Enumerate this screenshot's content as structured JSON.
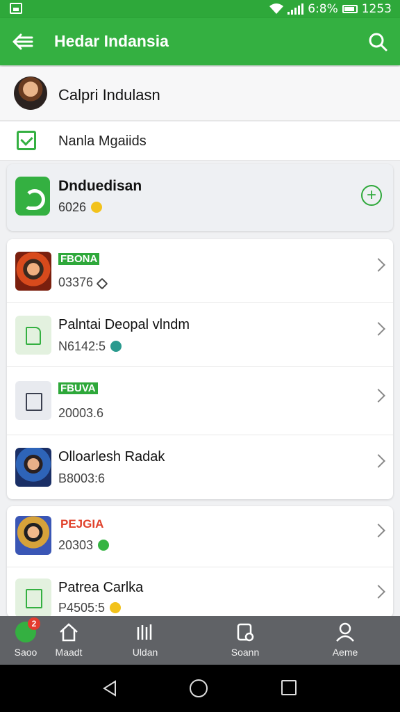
{
  "status_bar": {
    "battery_text": "6:8%",
    "time": "1253"
  },
  "app_bar": {
    "title": "Hedar Indansia",
    "back_icon": "back-arrow-icon",
    "search_icon": "search-icon",
    "background_color": "#34b041"
  },
  "account": {
    "name": "Calpri Indulasn"
  },
  "sub_row": {
    "label": "Nanla Mgaiids"
  },
  "featured": {
    "name": "Dnduedisan",
    "meta": "6026",
    "action_icon": "add-circle-icon"
  },
  "list1": [
    {
      "tag": "FBONA",
      "title": "",
      "sub": "03376",
      "thumb": "photo-a",
      "emoji": "outline"
    },
    {
      "tag": "",
      "title": "Palntai Deopal vlndm",
      "sub": "N6142:5",
      "thumb": "doc-green",
      "emoji": "teal"
    },
    {
      "tag": "FBUVA",
      "title": "",
      "sub": "20003.6",
      "thumb": "doc-grey",
      "emoji": ""
    },
    {
      "tag": "",
      "title": "Olloarlesh Radak",
      "sub": "B8003:6",
      "thumb": "photo-b",
      "emoji": ""
    }
  ],
  "list2": [
    {
      "tag": "PEJGIA",
      "title": "",
      "sub": "20303",
      "thumb": "photo-c",
      "emoji": "green"
    },
    {
      "tag": "",
      "title": "Patrea Carlka",
      "sub": "P4505:5",
      "thumb": "doc-green2",
      "emoji": "yellow"
    }
  ],
  "bottom_nav": [
    {
      "label": "Saoo",
      "icon": "chat-icon",
      "badge": "2"
    },
    {
      "label": "Maadt",
      "icon": "home-icon",
      "badge": ""
    },
    {
      "label": "Uldan",
      "icon": "bars-icon",
      "badge": ""
    },
    {
      "label": "Soann",
      "icon": "scan-icon",
      "badge": ""
    },
    {
      "label": "Aeme",
      "icon": "profile-icon",
      "badge": ""
    }
  ]
}
